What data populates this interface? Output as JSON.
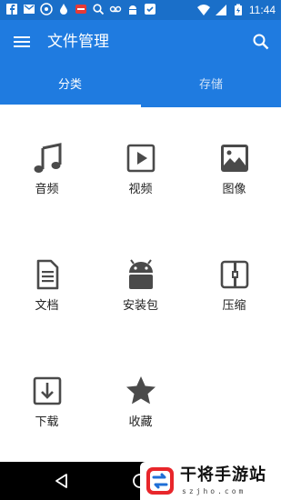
{
  "status_bar": {
    "time": "11:44",
    "icons": [
      "facebook-icon",
      "mail-icon",
      "app-icon",
      "water-icon",
      "badge-icon",
      "search-icon",
      "voicemail-icon",
      "android-icon",
      "check-icon"
    ],
    "right_icons": [
      "wifi-icon",
      "signal-icon",
      "battery-icon"
    ]
  },
  "app_bar": {
    "title": "文件管理",
    "menu_icon": "menu-icon",
    "search_icon": "search-icon"
  },
  "tabs": [
    {
      "label": "分类",
      "active": true
    },
    {
      "label": "存储",
      "active": false
    }
  ],
  "categories": [
    {
      "label": "音频",
      "icon": "music-note-icon"
    },
    {
      "label": "视频",
      "icon": "video-icon"
    },
    {
      "label": "图像",
      "icon": "image-icon"
    },
    {
      "label": "文档",
      "icon": "document-icon"
    },
    {
      "label": "安装包",
      "icon": "android-icon"
    },
    {
      "label": "压缩",
      "icon": "archive-icon"
    },
    {
      "label": "下载",
      "icon": "download-icon"
    },
    {
      "label": "收藏",
      "icon": "star-icon"
    }
  ],
  "nav_bar": {
    "back_icon": "back-icon",
    "home_icon": "home-icon"
  },
  "watermark": {
    "title": "干将手游站",
    "subtitle": "szjho.com"
  },
  "colors": {
    "primary": "#1f7be0",
    "status": "#1a6fc9",
    "icon": "#4a4a4a"
  }
}
